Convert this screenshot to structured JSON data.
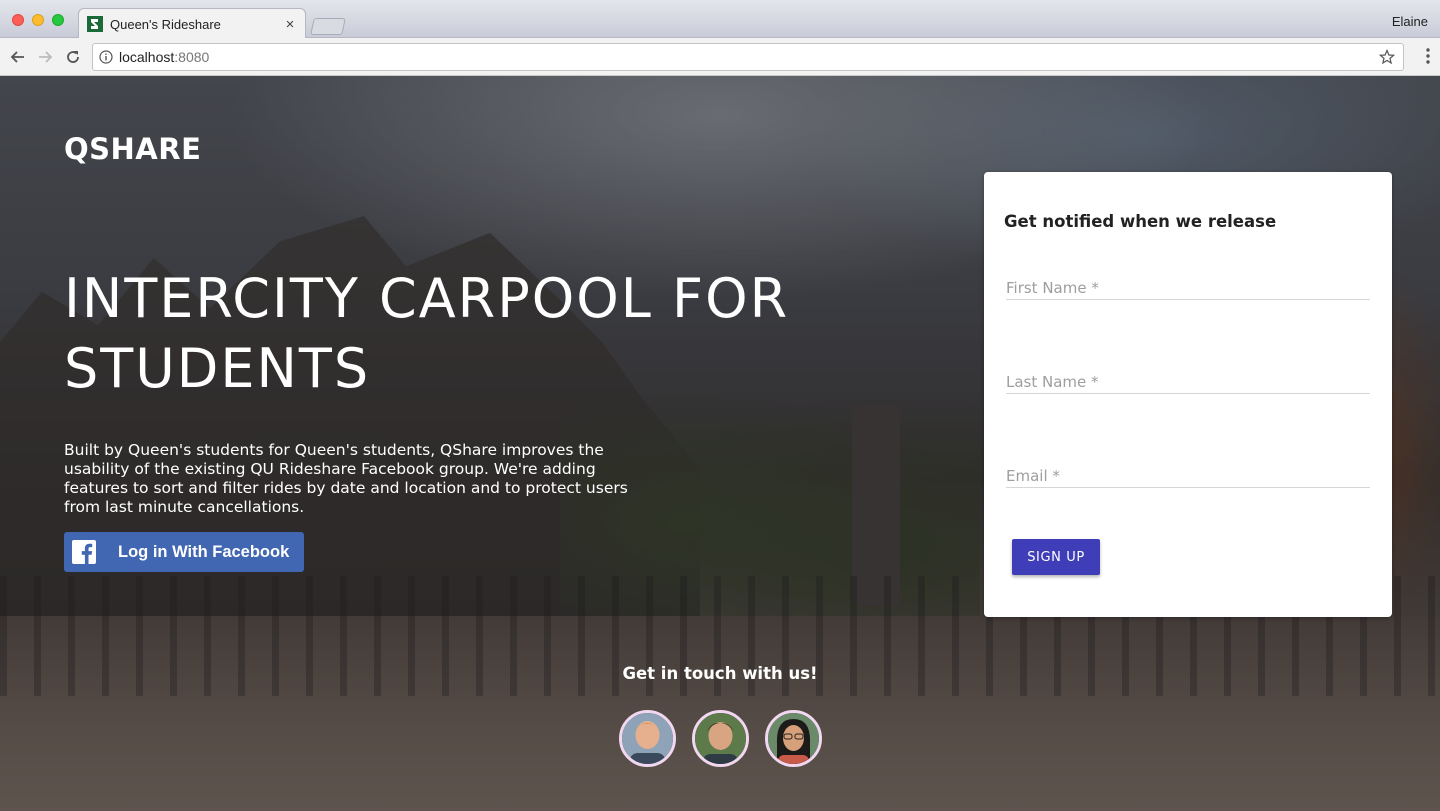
{
  "browser": {
    "tab_title": "Queen's Rideshare",
    "tab_close": "×",
    "profile_name": "Elaine",
    "url_host": "localhost",
    "url_port": ":8080"
  },
  "page": {
    "logo": "QSHARE",
    "hero_title": "INTERCITY CARPOOL FOR STUDENTS",
    "hero_description": "Built by Queen's students for Queen's students, QShare improves the usability of the existing QU Rideshare Facebook group. We're adding features to sort and filter rides by date and location and to protect users from last minute cancellations.",
    "facebook_button": "Log in With Facebook",
    "signup": {
      "heading": "Get notified when we release",
      "first_name_placeholder": "First Name *",
      "last_name_placeholder": "Last Name *",
      "email_placeholder": "Email *",
      "submit_label": "SIGN UP"
    },
    "contact_heading": "Get in touch with us!"
  },
  "colors": {
    "facebook_blue": "#4267b2",
    "signup_button": "#3f3db8",
    "avatar_ring": "#f1d8f0"
  },
  "icons": [
    "back-arrow-icon",
    "forward-arrow-icon",
    "reload-icon",
    "info-icon",
    "star-icon",
    "menu-dots-icon",
    "facebook-icon"
  ]
}
